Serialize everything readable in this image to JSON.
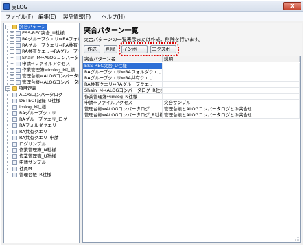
{
  "window": {
    "title": "実LOG",
    "close_glyph": "x"
  },
  "menu": [
    {
      "label": "ファイル(F)"
    },
    {
      "label": "編集(E)"
    },
    {
      "label": "製品情報(F)"
    },
    {
      "label": "ヘルプ(H)"
    }
  ],
  "tree": {
    "root1": {
      "label": "突合パターン",
      "expander": "−"
    },
    "children1": [
      {
        "label": "ESS-REC突合_U社様"
      },
      {
        "label": "RAグループクエリ⇔RAフォルダー"
      },
      {
        "label": "RAグループクエリ⇔RA共有クエ"
      },
      {
        "label": "RA共有クエリ⇔RAグループクエ"
      },
      {
        "label": "Shain_M⇔ALOGコンバータログ"
      },
      {
        "label": "申請⇔ファイルアクセス"
      },
      {
        "label": "作業管理簿⇔imlog_N社様"
      },
      {
        "label": "管理台帳⇔ALOGコンバータログ"
      },
      {
        "label": "管理台帳⇔ALOGコンバータログ"
      }
    ],
    "root2": {
      "label": "項目定義",
      "expander": "−"
    },
    "children2": [
      {
        "label": "ALOGコンバータログ"
      },
      {
        "label": "DETECT記録_U社様"
      },
      {
        "label": "imlog_N社様"
      },
      {
        "label": "RAグループクエリ"
      },
      {
        "label": "RAグループクエリ_ログ"
      },
      {
        "label": "RAフォルダクエリ"
      },
      {
        "label": "RA共有クエリ"
      },
      {
        "label": "RA共有クエリ_申請"
      },
      {
        "label": "ログサンプル"
      },
      {
        "label": "作業管理簿_N社様"
      },
      {
        "label": "作業管理簿_U社様"
      },
      {
        "label": "申請サンプル"
      },
      {
        "label": "社員M"
      },
      {
        "label": "管理台帳_R社様"
      }
    ],
    "expander_plus": "+"
  },
  "main": {
    "heading": "突合パターン一覧",
    "description": "突合パターンの一覧表示または作成、削除を行います。",
    "buttons": {
      "create": "作成",
      "delete": "削除",
      "import": "インポート",
      "export": "エクスポート"
    },
    "table": {
      "columns": [
        "突合パターン名",
        "説明"
      ],
      "rows": [
        [
          "ESS-REC突合_U社様",
          ""
        ],
        [
          "RAグループクエリ⇔RAフォルダクエリ",
          ""
        ],
        [
          "RAグループクエリ⇔RA共有クエリ",
          ""
        ],
        [
          "RA共有クエリ⇔RAグループクエリ",
          ""
        ],
        [
          "Shain_M⇔ALOGコンバータログ_R社様",
          ""
        ],
        [
          "作業管理簿⇔imlog_N社様",
          ""
        ],
        [
          "申請⇔ファイルアクセス",
          "突合サンプル"
        ],
        [
          "管理台帳⇔ALOGコンバータログ",
          "管理台帳とALOGコンバータログとの突合せ"
        ],
        [
          "管理台帳⇔ALOGコンバータログ_R社様",
          "管理台帳とALOGコンバータログとの突合せ"
        ]
      ]
    }
  },
  "colors": {
    "selection": "#2d6fd6",
    "highlight_outline": "#e00000"
  }
}
